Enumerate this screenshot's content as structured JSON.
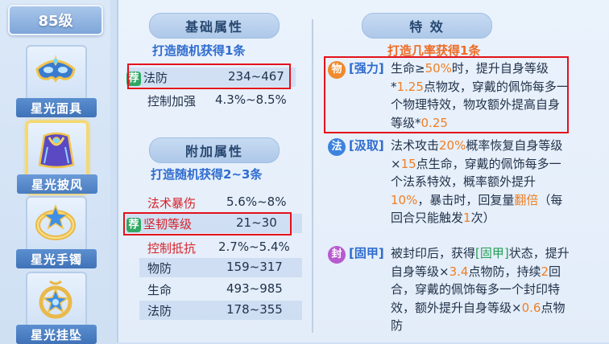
{
  "sidebar": {
    "level_tab": "85级",
    "items": [
      {
        "label": "星光面具",
        "icon": "mask-icon",
        "selected": false
      },
      {
        "label": "星光披风",
        "icon": "cape-icon",
        "selected": true
      },
      {
        "label": "星光手镯",
        "icon": "bracelet-icon",
        "selected": false
      },
      {
        "label": "星光挂坠",
        "icon": "pendant-icon",
        "selected": false
      }
    ]
  },
  "basic": {
    "title": "基础属性",
    "subtitle": "打造随机获得1条",
    "recommend_badge": "荐",
    "rows": [
      {
        "name": "法防",
        "value": "234~467"
      },
      {
        "name": "控制加强",
        "value": "4.3%~8.5%"
      }
    ]
  },
  "extra": {
    "title": "附加属性",
    "subtitle": "打造随机获得2~3条",
    "recommend_badge": "荐",
    "rows": [
      {
        "name": "法术暴伤",
        "value": "5.6%~8%"
      },
      {
        "name": "坚韧等级",
        "value": "21~30"
      },
      {
        "name": "控制抵抗",
        "value": "2.7%~5.4%"
      },
      {
        "name": "物防",
        "value": "159~317"
      },
      {
        "name": "生命",
        "value": "493~985"
      },
      {
        "name": "法防",
        "value": "178~355"
      }
    ]
  },
  "special": {
    "title": "特 效",
    "subtitle": "打造几率获得1条",
    "effects": [
      {
        "icon_char": "物",
        "icon_color": "#f08a2c",
        "tag": "[强力]",
        "t1": "生命≥",
        "n1": "50%",
        "t2": "时，提升自身等级*",
        "n2": "1.25",
        "t3": "点物攻，穿戴的佩饰每多一个物理特效，物攻额外提高自身等级*",
        "n3": "0.25",
        "t4": ""
      },
      {
        "icon_char": "法",
        "icon_color": "#3c83dd",
        "tag": "[汲取]",
        "t1": "法术攻击",
        "n1": "20%",
        "t2": "概率恢复自身等级×",
        "n2": "15",
        "t3": "点生命，穿戴的佩饰每多一个法系特效，概率额外提升",
        "n3": "10%",
        "t4": "，暴击时，回复量",
        "n4": "翻倍",
        "t5": "（每回合只能触发",
        "n5": "1",
        "t6": "次）"
      },
      {
        "icon_char": "封",
        "icon_color": "#b85ad0",
        "tag": "[固甲]",
        "t1": "被封印后，获得",
        "n1": "[固甲]",
        "t2": "状态，提升自身等级×",
        "n2": "3.4",
        "t3": "点物防，持续",
        "n3": "2",
        "t4": "回合，穿戴的佩饰每多一个封印特效，额外提升自身等级×",
        "n4": "0.6",
        "t5": "点物防"
      }
    ]
  },
  "colors": {
    "accent_blue": "#2f6ccf",
    "orange": "#ef7f24",
    "red": "#d8222a",
    "highlight_box": "#e3111c",
    "green": "#22a055"
  }
}
